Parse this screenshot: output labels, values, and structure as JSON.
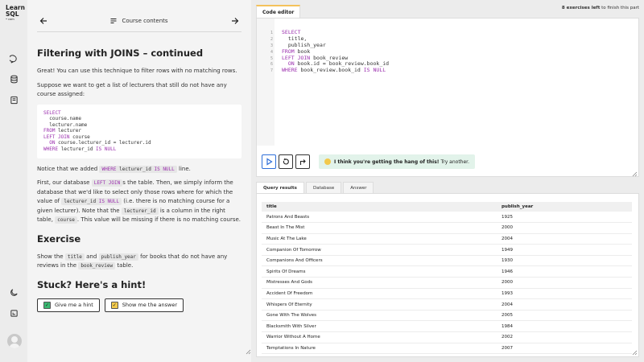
{
  "logo": {
    "line1": "Learn",
    "line2": "SQL",
    "sub": "• com"
  },
  "topnav": {
    "title": "Course contents"
  },
  "lesson": {
    "title": "Filtering with JOINS – continued",
    "p1": "Great! You can use this technique to filter rows with no matching rows.",
    "p2": "Suppose we want to get a list of lecturers that still do not have any course assigned:",
    "code_example": [
      [
        {
          "t": "SELECT",
          "k": true
        }
      ],
      [
        {
          "t": "  course.name",
          "k": false
        }
      ],
      [
        {
          "t": "  lecturer.name",
          "k": false
        }
      ],
      [
        {
          "t": "FROM ",
          "k": true
        },
        {
          "t": "lecturer",
          "k": false
        }
      ],
      [
        {
          "t": "LEFT JOIN ",
          "k": true
        },
        {
          "t": "course",
          "k": false
        }
      ],
      [
        {
          "t": "  ON ",
          "k": true
        },
        {
          "t": "course.lecturer_id = lecturer.id",
          "k": false
        }
      ],
      [
        {
          "t": "WHERE ",
          "k": true
        },
        {
          "t": "lecturer_id ",
          "k": false
        },
        {
          "t": "IS NULL",
          "k": true
        }
      ]
    ],
    "p3_before": "Notice that we added",
    "p3_code_a": "WHERE",
    "p3_code_b": " lecturer_id ",
    "p3_code_c": "IS NULL",
    "p3_after": "line.",
    "p4_a": "First, our database",
    "p4_code1": "LEFT JOIN",
    "p4_b": "s the table. Then, we simply inform the database that we'd like to select only those rows where for which the value of",
    "p4_code2": "lecturer_id",
    "p4_code2b": "IS NULL",
    "p4_c": "(i.e. there is no matching course for a given lecturer). Note that the",
    "p4_code3": "lecturer_id",
    "p4_d": "is a column in the right table,",
    "p4_code4": "course",
    "p4_e": ". This value will be missing if there is no matching course.",
    "exercise_heading": "Exercise",
    "ex_a": "Show the",
    "ex_code1": "title",
    "ex_b": "and",
    "ex_code2": "publish_year",
    "ex_c": "for books that do not have any reviews in the",
    "ex_code3": "book_review",
    "ex_d": "table.",
    "hint_heading": "Stuck? Here's a hint!",
    "hint_button": "Give me a hint",
    "answer_button": "Show me the answer"
  },
  "editor": {
    "tab_label": "Code editor",
    "exercises_left_bold": "8 exercises left",
    "exercises_left_rest": " to finish this part",
    "line_numbers": [
      "1",
      "2",
      "3",
      "4",
      "5",
      "6",
      "7"
    ],
    "code": [
      [
        {
          "t": "SELECT",
          "k": true
        }
      ],
      [
        {
          "t": "  title,",
          "k": false
        }
      ],
      [
        {
          "t": "  publish_year",
          "k": false
        }
      ],
      [
        {
          "t": "FROM ",
          "k": true
        },
        {
          "t": "book",
          "k": false
        }
      ],
      [
        {
          "t": "LEFT JOIN ",
          "k": true
        },
        {
          "t": "book_review",
          "k": false
        }
      ],
      [
        {
          "t": "  ON ",
          "k": true
        },
        {
          "t": "book.id = book_review.book_id",
          "k": false
        }
      ],
      [
        {
          "t": "WHERE ",
          "k": true
        },
        {
          "t": "book_review.book_id ",
          "k": false
        },
        {
          "t": "IS NULL",
          "k": true
        }
      ]
    ],
    "toast_bold": "I think you're getting the hang of this!",
    "toast_rest": " Try another."
  },
  "results": {
    "tabs": [
      "Query results",
      "Database",
      "Answer"
    ],
    "columns": [
      "title",
      "publish_year"
    ],
    "rows": [
      [
        "Patrons And Beasts",
        "1925"
      ],
      [
        "Beast In The Mist",
        "2000"
      ],
      [
        "Music At The Lake",
        "2004"
      ],
      [
        "Companion Of Tomorrow",
        "1949"
      ],
      [
        "Companions And Officers",
        "1930"
      ],
      [
        "Spirits Of Dreams",
        "1946"
      ],
      [
        "Mistresses And Gods",
        "2000"
      ],
      [
        "Accident Of Freedom",
        "1993"
      ],
      [
        "Whispers Of Eternity",
        "2004"
      ],
      [
        "Gone With The Wolves",
        "2005"
      ],
      [
        "Blacksmith With Silver",
        "1984"
      ],
      [
        "Warrior Without A Home",
        "2002"
      ],
      [
        "Temptations In Nature",
        "2007"
      ]
    ]
  },
  "colors": {
    "keyword": "#9b2fae",
    "run_blue": "#2f6fd8",
    "tab_accent": "#f4c25b",
    "toast_bg": "#e2f3ea"
  }
}
